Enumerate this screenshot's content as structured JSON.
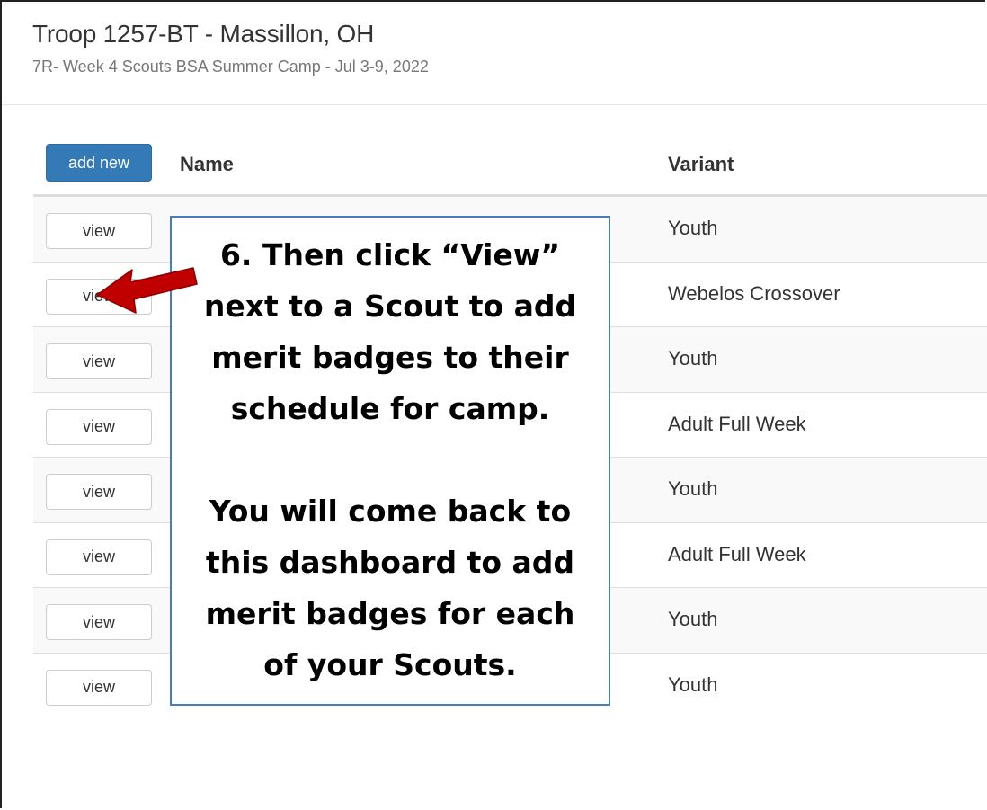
{
  "header": {
    "title": "Troop 1257-BT - Massillon, OH",
    "subtitle": "7R- Week 4 Scouts BSA Summer Camp - Jul 3-9, 2022"
  },
  "table": {
    "add_button_label": "add new",
    "columns": {
      "name": "Name",
      "variant": "Variant"
    },
    "rows": [
      {
        "action": "view",
        "variant": "Youth"
      },
      {
        "action": "view",
        "variant": "Webelos Crossover"
      },
      {
        "action": "view",
        "variant": "Youth"
      },
      {
        "action": "view",
        "variant": "Adult Full Week"
      },
      {
        "action": "view",
        "variant": "Youth"
      },
      {
        "action": "view",
        "variant": "Adult Full Week"
      },
      {
        "action": "view",
        "variant": "Youth"
      },
      {
        "action": "view",
        "variant": "Youth"
      }
    ]
  },
  "callout": {
    "lines_1": [
      "6. Then click “View”",
      "next to a Scout to add",
      "merit badges to their",
      "schedule for camp."
    ],
    "lines_2": [
      "You will come back to",
      "this dashboard to add",
      "merit badges for each",
      "of your Scouts."
    ]
  },
  "colors": {
    "primary": "#337ab7",
    "arrow": "#c00000",
    "callout_border": "#4a7bc0"
  },
  "icons": {
    "pointer": "red-arrow-icon"
  }
}
